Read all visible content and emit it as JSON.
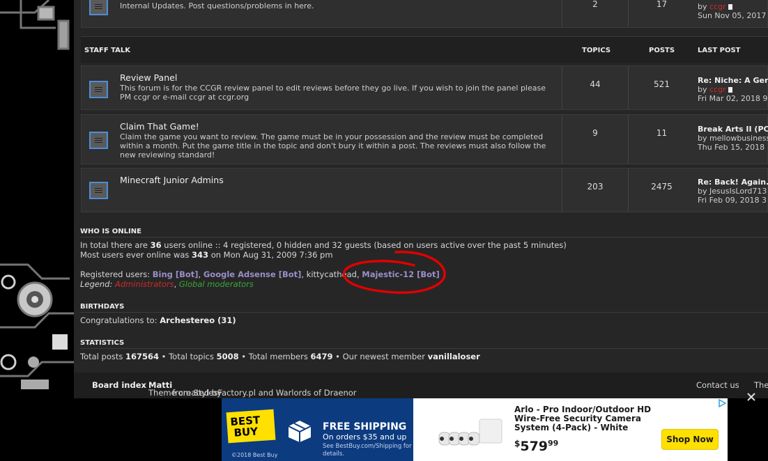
{
  "top_forum": {
    "description": "Internal Updates. Post questions/problems in here.",
    "topics": "2",
    "posts": "17",
    "last_by_prefix": "by",
    "last_by_user": "ccgr",
    "last_date": "Sun Nov 05, 2017"
  },
  "category": {
    "title": "STAFF TALK",
    "col_topics": "TOPICS",
    "col_posts": "POSTS",
    "col_last": "LAST POST"
  },
  "forums": [
    {
      "title": "Review Panel",
      "description": "This forum is for the CCGR review panel to edit reviews before they go live. If you wish to join the panel please PM ccgr or e-mail ccgr at ccgr.org",
      "topics": "44",
      "posts": "521",
      "last_title": "Re: Niche: A Gen",
      "last_by_prefix": "by",
      "last_by_user": "ccgr",
      "last_date": "Fri Mar 02, 2018 9"
    },
    {
      "title": "Claim That Game!",
      "description": "Claim the game you want to review. The game must be in your possession and the review must be completed within a month. Put the game title in the topic and don't bury it within a post. The reviews must also follow the new reviewing standard!",
      "topics": "9",
      "posts": "11",
      "last_title": "Break Arts II (PC",
      "last_by_prefix": "by",
      "last_by_user": "mellowbusiness",
      "last_date": "Thu Feb 15, 2018"
    },
    {
      "title": "Minecraft Junior Admins",
      "description": "",
      "topics": "203",
      "posts": "2475",
      "last_title": "Re: Back! Again.",
      "last_by_prefix": "by",
      "last_by_user": "JesusIsLord713",
      "last_date": "Fri Feb 09, 2018 3"
    }
  ],
  "who_is_online": {
    "heading": "WHO IS ONLINE",
    "line1_a": "In total there are ",
    "line1_count": "36",
    "line1_b": " users online :: 4 registered, 0 hidden and 32 guests (based on users active over the past 5 minutes)",
    "line2_a": "Most users ever online was ",
    "line2_count": "343",
    "line2_b": " on Mon Aug 31, 2009 7:36 pm",
    "registered_label": "Registered users: ",
    "users": [
      "Bing [Bot]",
      "Google Adsense [Bot]",
      "kittycathead",
      "Majestic-12 [Bot]"
    ],
    "sep": ", ",
    "legend_label": "Legend: ",
    "legend_admin": "Administrators",
    "legend_mod": "Global moderators"
  },
  "birthdays": {
    "heading": "BIRTHDAYS",
    "text": "Congratulations to: ",
    "name": "Archestereo (31)"
  },
  "statistics": {
    "heading": "STATISTICS",
    "posts_label": "Total posts ",
    "posts": "167564",
    "topics_label": " • Total topics ",
    "topics": "5008",
    "members_label": " • Total members ",
    "members": "6479",
    "newest_label": " • Our newest member ",
    "newest": "vanillaloser"
  },
  "footer": {
    "board_index": "Board index",
    "theme_a": "Theme created by ",
    "theme_author": "Matti",
    "theme_b": " from StylesFactory.pl and Warlords of Draenor",
    "contact": "Contact us",
    "the": "The"
  },
  "ad": {
    "logo_line1": "BEST",
    "logo_line2": "BUY",
    "copyright": "©2018 Best Buy",
    "ship_heading": "FREE SHIPPING",
    "ship_sub": "On orders $35 and up",
    "ship_fine": "See BestBuy.com/Shipping for details.",
    "product": "Arlo - Pro Indoor/Outdoor HD Wire-Free Security Camera System (4-Pack) - White",
    "price_dollar": "$",
    "price_whole": "579",
    "price_cents": "99",
    "button": "Shop Now"
  },
  "colors": {
    "admin": "#cc2a2a",
    "global_mod": "#3aa63a",
    "bot": "#9a8fc8",
    "icon_border": "#4d8ed9",
    "annotation": "#e00000",
    "bestbuy_blue": "#0c3b80",
    "bestbuy_yellow": "#ffe000"
  }
}
